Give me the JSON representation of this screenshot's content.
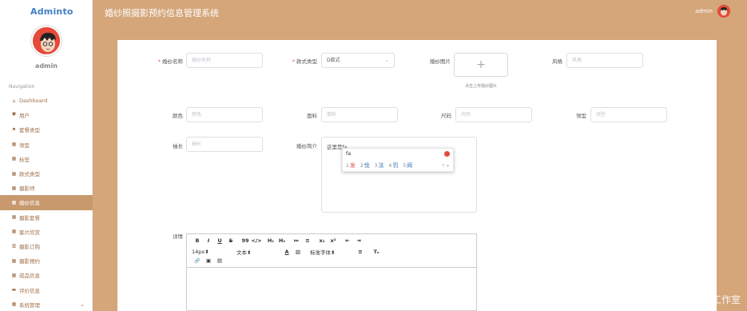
{
  "app": {
    "logo": "Adminto",
    "title": "婚纱照摄影预约信息管理系统",
    "user": "admin"
  },
  "sidebar": {
    "username": "admin",
    "nav_title": "Navigation",
    "items": [
      {
        "label": "Dashboard",
        "icon": "home-icon"
      },
      {
        "label": "用户",
        "icon": "shield-icon"
      },
      {
        "label": "套餐类型",
        "icon": "flag-icon"
      },
      {
        "label": "领型",
        "icon": "grid-icon"
      },
      {
        "label": "标签",
        "icon": "grid-icon"
      },
      {
        "label": "款式类型",
        "icon": "grid-icon"
      },
      {
        "label": "摄影师",
        "icon": "grid-icon"
      },
      {
        "label": "婚纱信息",
        "icon": "grid-icon",
        "active": true
      },
      {
        "label": "摄影套餐",
        "icon": "grid-icon"
      },
      {
        "label": "客片欣赏",
        "icon": "grid-icon"
      },
      {
        "label": "摄影订购",
        "icon": "chart-icon"
      },
      {
        "label": "摄影预约",
        "icon": "grid-icon"
      },
      {
        "label": "成品信息",
        "icon": "grid-icon"
      },
      {
        "label": "评价信息",
        "icon": "comment-icon"
      },
      {
        "label": "系统管理",
        "icon": "grid-icon",
        "has_children": true
      }
    ]
  },
  "form": {
    "name": {
      "label": "婚纱名称",
      "placeholder": "婚纱名称",
      "required": true
    },
    "style_type": {
      "label": "款式类型",
      "value": "D款式",
      "required": true
    },
    "image": {
      "label": "婚纱图片",
      "hint": "点击上传婚纱图片",
      "plus": "+"
    },
    "style": {
      "label": "风格",
      "placeholder": "风格"
    },
    "color": {
      "label": "颜色",
      "placeholder": "颜色"
    },
    "fabric": {
      "label": "面料",
      "placeholder": "面料"
    },
    "size": {
      "label": "尺码",
      "placeholder": "尺码"
    },
    "collar": {
      "label": "领型",
      "placeholder": "领型"
    },
    "sleeve": {
      "label": "袖长",
      "placeholder": "袖长"
    },
    "intro": {
      "label": "婚纱简介",
      "value": "这里是fa"
    },
    "detail": {
      "label": "详情"
    }
  },
  "ime": {
    "composition": "fa",
    "candidates": [
      {
        "num": "1",
        "text": "发"
      },
      {
        "num": "2",
        "text": "伐"
      },
      {
        "num": "3",
        "text": "法"
      },
      {
        "num": "4",
        "text": "罚"
      },
      {
        "num": "5",
        "text": "阀"
      }
    ],
    "nav": "› ⌄"
  },
  "editor": {
    "row1": [
      "B",
      "I",
      "U",
      "S",
      "99",
      "</>",
      "H₁",
      "H₂",
      "≔",
      "≡",
      "x₂",
      "x²",
      "⇤",
      "⇥"
    ],
    "font_size": "14px",
    "text_style": "文本",
    "font_family": "标准字体",
    "row2_icons": [
      "A",
      "▧",
      "≡",
      "Tₓ"
    ],
    "row3": [
      "🔗",
      "▣",
      "▤"
    ]
  },
  "watermark": "CSDN @计算机毕设工作室"
}
